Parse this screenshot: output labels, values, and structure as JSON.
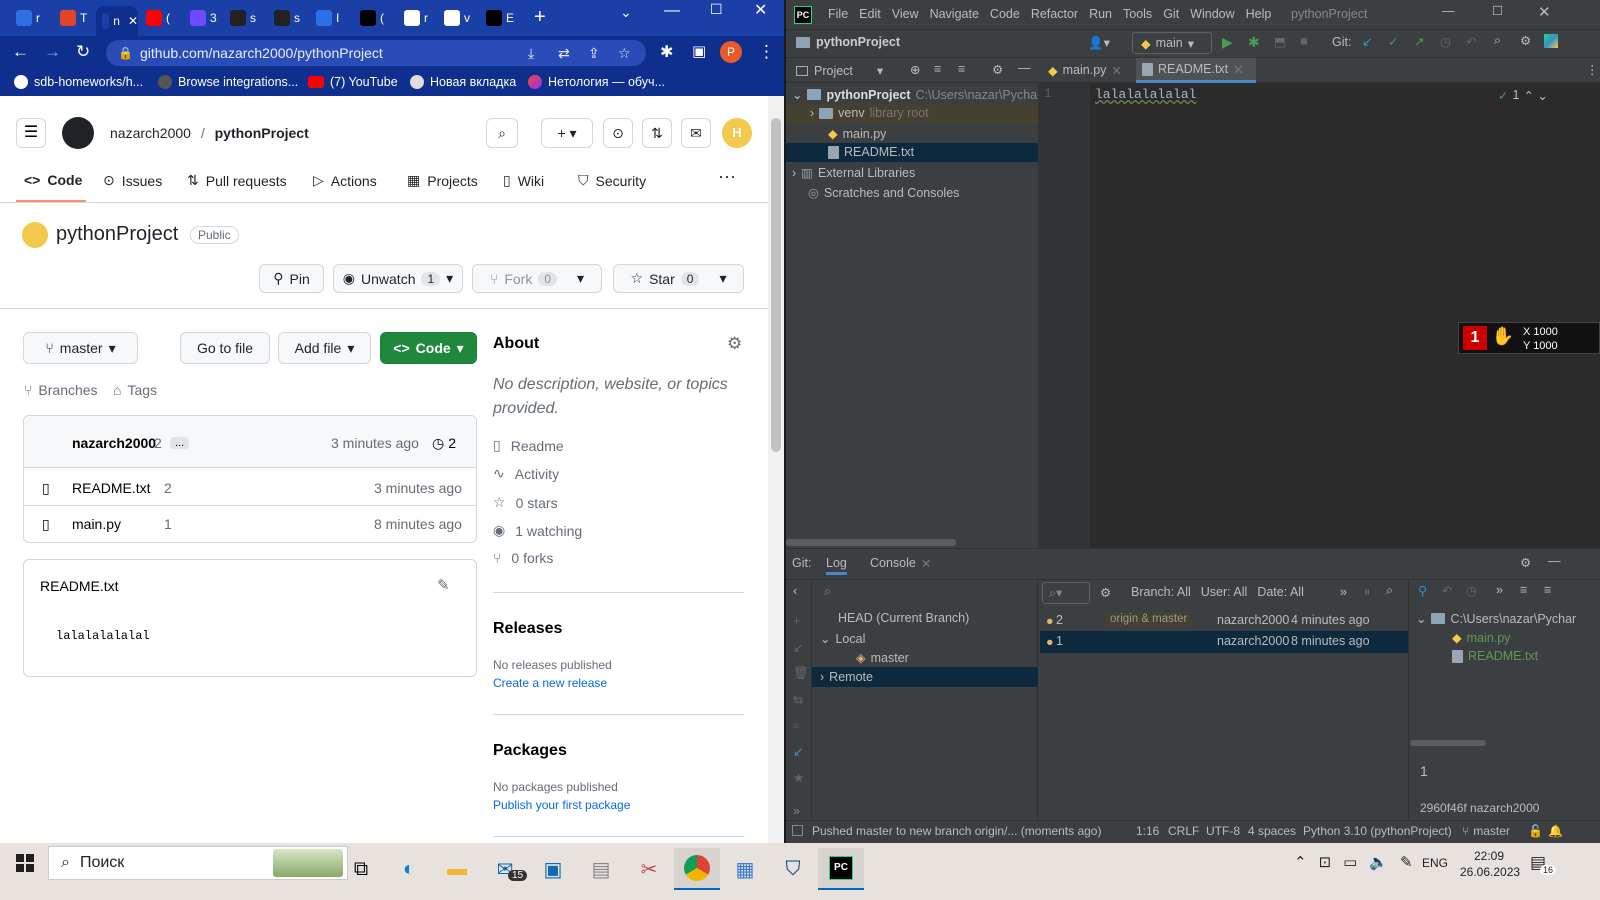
{
  "chrome": {
    "tabs": [
      {
        "label": "r",
        "color": "#2f6fe4"
      },
      {
        "label": "T",
        "color": "#e24329"
      },
      {
        "label": "n",
        "color": "#1a3fa6"
      },
      {
        "label": "(",
        "color": "#ff0000"
      },
      {
        "label": "3",
        "color": "#6d4aff"
      },
      {
        "label": "s",
        "color": "#222222"
      },
      {
        "label": "s",
        "color": "#222222"
      },
      {
        "label": "I",
        "color": "#2f6fe4"
      },
      {
        "label": "(",
        "color": "#000000"
      },
      {
        "label": "r",
        "color": "#ffffff"
      },
      {
        "label": "v",
        "color": "#ffffff"
      },
      {
        "label": "E",
        "color": "#000000"
      }
    ],
    "url": "github.com/nazarch2000/pythonProject",
    "profile_initial": "P",
    "bookmarks": [
      "sdb-homeworks/h...",
      "Browse integrations...",
      "(7) YouTube",
      "Новая вкладка",
      "Нетология — обуч..."
    ]
  },
  "github": {
    "owner": "nazarch2000",
    "repo": "pythonProject",
    "nav": [
      "Code",
      "Issues",
      "Pull requests",
      "Actions",
      "Projects",
      "Wiki",
      "Security"
    ],
    "visibility": "Public",
    "pin": "Pin",
    "unwatch": "Unwatch",
    "watch_count": "1",
    "fork": "Fork",
    "fork_count": "0",
    "star": "Star",
    "star_count": "0",
    "branch": "master",
    "go_to_file": "Go to file",
    "add_file": "Add file",
    "code_btn": "Code",
    "branches": "Branches",
    "tags": "Tags",
    "commit_author": "nazarch2000",
    "commit_msg": "2",
    "commit_more": "...",
    "commit_time": "3 minutes ago",
    "commit_count": "2",
    "files": [
      {
        "name": "README.txt",
        "msg": "2",
        "time": "3 minutes ago"
      },
      {
        "name": "main.py",
        "msg": "1",
        "time": "8 minutes ago"
      }
    ],
    "readme_title": "README.txt",
    "readme_content": "lalalalalalal",
    "about_title": "About",
    "about_desc": "No description, website, or topics provided.",
    "about_items": [
      "Readme",
      "Activity",
      "0 stars",
      "1 watching",
      "0 forks"
    ],
    "releases_title": "Releases",
    "releases_none": "No releases published",
    "releases_link": "Create a new release",
    "packages_title": "Packages",
    "packages_none": "No packages published",
    "packages_link": "Publish your first package"
  },
  "pycharm": {
    "menu": [
      "File",
      "Edit",
      "View",
      "Navigate",
      "Code",
      "Refactor",
      "Run",
      "Tools",
      "Git",
      "Window",
      "Help"
    ],
    "title": "pythonProject",
    "project_name": "pythonProject",
    "branch": "main",
    "git_label": "Git:",
    "project_view": "Project",
    "tabs": [
      "main.py",
      "README.txt"
    ],
    "tree": {
      "root": "pythonProject",
      "root_path": "C:\\Users\\nazar\\Pycharm",
      "venv": "venv",
      "venv_note": "library root",
      "files": [
        "main.py",
        "README.txt"
      ],
      "external": "External Libraries",
      "scratches": "Scratches and Consoles"
    },
    "editor": {
      "line_no": "1",
      "text": "lalalalalalal",
      "inspections": "1"
    },
    "overlay": {
      "x": "X 1000",
      "y": "Y 1000"
    },
    "git": {
      "label": "Git:",
      "tabs": [
        "Log",
        "Console"
      ],
      "filters": [
        "Branch: All",
        "User: All",
        "Date: All"
      ],
      "branches_head": "HEAD (Current Branch)",
      "local": "Local",
      "master": "master",
      "remote": "Remote",
      "commits": [
        {
          "msg": "2",
          "tags": "origin & master",
          "author": "nazarch2000",
          "time": "4 minutes ago"
        },
        {
          "msg": "1",
          "tags": "",
          "author": "nazarch2000",
          "time": "8 minutes ago"
        }
      ],
      "changes_path": "C:\\Users\\nazar\\Pychar",
      "changes_files": [
        "main.py",
        "README.txt"
      ],
      "detail_msg": "1",
      "detail_hash": "2960f46f nazarch2000"
    },
    "status": {
      "message": "Pushed master to new branch origin/... (moments ago)",
      "pos": "1:16",
      "eol": "CRLF",
      "enc": "UTF-8",
      "indent": "4 spaces",
      "interp": "Python 3.10 (pythonProject)",
      "branch": "master"
    }
  },
  "taskbar": {
    "search": "Поиск",
    "mail_badge": "15",
    "lang": "ENG",
    "time": "22:09",
    "date": "26.06.2023",
    "notif": "16"
  }
}
